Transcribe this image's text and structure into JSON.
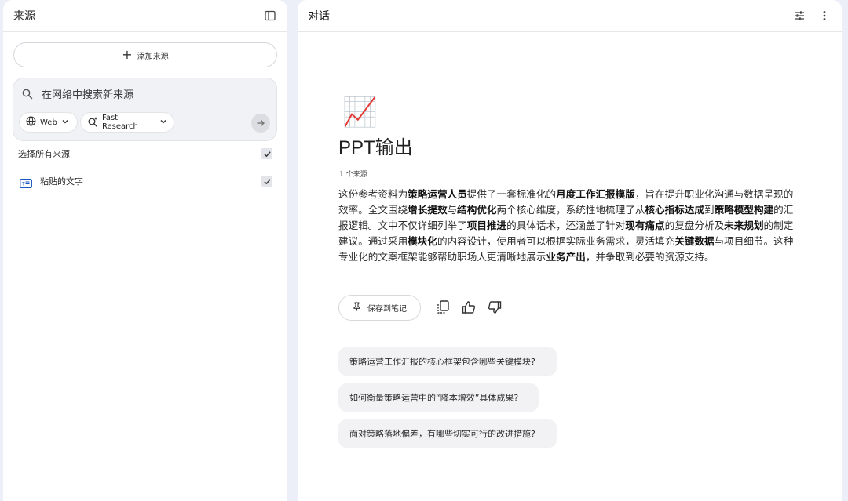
{
  "sources_panel": {
    "title": "来源",
    "add_source_label": "添加来源",
    "search": {
      "placeholder": "在网络中搜索新来源",
      "web_chip_label": "Web",
      "research_chip_label": "Fast Research"
    },
    "select_all_label": "选择所有来源",
    "items": [
      {
        "label": "粘贴的文字",
        "checked": true
      }
    ]
  },
  "chat_panel": {
    "title": "对话",
    "emoji": "📈",
    "doc_title": "PPT输出",
    "source_count": "1 个来源",
    "summary_segments": [
      {
        "text": "这份参考资料为",
        "bold": false
      },
      {
        "text": "策略运营人员",
        "bold": true
      },
      {
        "text": "提供了一套标准化的",
        "bold": false
      },
      {
        "text": "月度工作汇报模版",
        "bold": true
      },
      {
        "text": "，旨在提升职业化沟通与数据呈现的效率。全文围绕",
        "bold": false
      },
      {
        "text": "增长提效",
        "bold": true
      },
      {
        "text": "与",
        "bold": false
      },
      {
        "text": "结构优化",
        "bold": true
      },
      {
        "text": "两个核心维度，系统性地梳理了从",
        "bold": false
      },
      {
        "text": "核心指标达成",
        "bold": true
      },
      {
        "text": "到",
        "bold": false
      },
      {
        "text": "策略模型构建",
        "bold": true
      },
      {
        "text": "的汇报逻辑。文中不仅详细列举了",
        "bold": false
      },
      {
        "text": "项目推进",
        "bold": true
      },
      {
        "text": "的具体话术，还涵盖了针对",
        "bold": false
      },
      {
        "text": "现有痛点",
        "bold": true
      },
      {
        "text": "的复盘分析及",
        "bold": false
      },
      {
        "text": "未来规划",
        "bold": true
      },
      {
        "text": "的制定建议。通过采用",
        "bold": false
      },
      {
        "text": "模块化",
        "bold": true
      },
      {
        "text": "的内容设计，使用者可以根据实际业务需求，灵活填充",
        "bold": false
      },
      {
        "text": "关键数据",
        "bold": true
      },
      {
        "text": "与项目细节。这种专业化的文案框架能够帮助职场人更清晰地展示",
        "bold": false
      },
      {
        "text": "业务产出",
        "bold": true
      },
      {
        "text": "，并争取到必要的资源支持。",
        "bold": false
      }
    ],
    "save_note_label": "保存到笔记",
    "suggestions": [
      "策略运营工作汇报的核心框架包含哪些关键模块?",
      "如何衡量策略运营中的“降本增效”具体成果?",
      "面对策略落地偏差，有哪些切实可行的改进措施?"
    ]
  },
  "colors": {
    "page_background": "#eceef8",
    "panel_background": "#ffffff",
    "suggestion_background": "#f2f2f4",
    "search_box_background": "#f1f2f6",
    "source_icon": "#1a56c4"
  }
}
